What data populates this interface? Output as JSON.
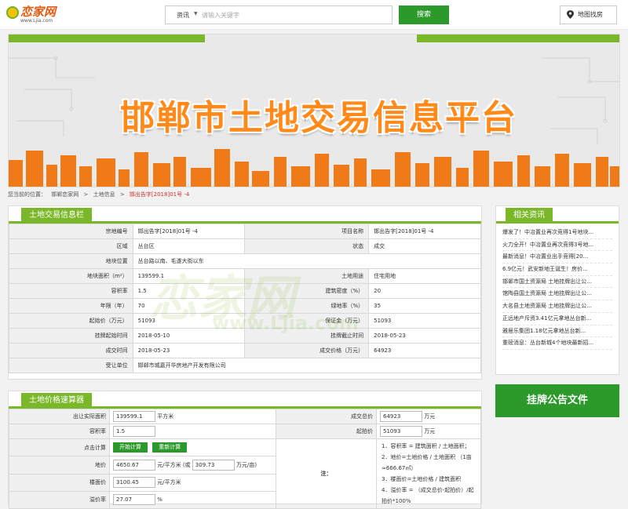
{
  "header": {
    "logo_text": "恋家网",
    "logo_sub": "www.Ljia.com",
    "search_category": "资讯",
    "search_placeholder": "请输入关键字",
    "search_button": "搜索",
    "map_button": "地图找房"
  },
  "banner": {
    "title": "邯郸市土地交易信息平台"
  },
  "breadcrumb": {
    "prefix": "您当前的位置：",
    "items": [
      "邯郸恋家网",
      ">",
      "土地信息",
      ">",
      "邯出告字[2018]01号 -4"
    ]
  },
  "land_info": {
    "title": "土地交易信息栏",
    "rows": [
      {
        "k1": "宗地编号",
        "v1": "邯出告字[2018]01号 -4",
        "k2": "项目名称",
        "v2": "邯出告字[2018]01号 -4"
      },
      {
        "k1": "区域",
        "v1": "丛台区",
        "k2": "状态",
        "v2": "成交"
      },
      {
        "k1": "地块位置",
        "v1": "丛台路以南、毛遂大街以东",
        "k2": "",
        "v2": ""
      },
      {
        "k1": "地块面积（m²）",
        "v1": "139599.1",
        "k2": "土地用途",
        "v2": "住宅用地"
      },
      {
        "k1": "容积率",
        "v1": "1.5",
        "k2": "建筑密度（%）",
        "v2": "20"
      },
      {
        "k1": "年限（年）",
        "v1": "70",
        "k2": "绿地率（%）",
        "v2": "35"
      },
      {
        "k1": "起始价（万元）",
        "v1": "51093",
        "k2": "保证金（万元）",
        "v2": "51093"
      },
      {
        "k1": "挂牌起始时间",
        "v1": "2018-05-10",
        "k2": "挂牌截止时间",
        "v2": "2018-05-23"
      },
      {
        "k1": "成交时间",
        "v1": "2018-05-23",
        "k2": "成交价格（万元）",
        "v2": "64923"
      },
      {
        "k1": "受让单位",
        "v1": "邯郸市城嘉开华房地产开发有限公司",
        "k2": "",
        "v2": ""
      }
    ]
  },
  "watermark": {
    "text": "恋家网",
    "sub": "www.Ljia.com"
  },
  "calculator": {
    "title": "土地价格速算器",
    "area_label": "出让实际面积",
    "area_value": "139599.1",
    "area_unit": "平方米",
    "deal_label": "成交总价",
    "deal_value": "64923",
    "deal_unit": "万元",
    "far_label": "容积率",
    "far_value": "1.5",
    "start_label": "起拍价",
    "start_value": "51093",
    "start_unit": "万元",
    "action_label": "点击计算",
    "calc_button": "开始计算",
    "reset_button": "重新计算",
    "land_price_label": "地价",
    "land_price_value": "4650.67",
    "land_price_unit": "元/平方米 (或",
    "land_price_mu": "309.73",
    "land_price_mu_unit": "万元/亩)",
    "floor_price_label": "楼面价",
    "floor_price_value": "3100.45",
    "floor_price_unit": "元/平方米",
    "premium_label": "溢价率",
    "premium_value": "27.07",
    "premium_unit": "%",
    "note_label": "注：",
    "notes": [
      "1．容积率 = 建筑面积 / 土地面积；",
      "2．地价=土地价格 / 土地面积 （1亩≈666.67㎡）",
      "3．楼面价=土地价格 / 建筑面积",
      "4．溢价率 = （成交总价-起拍价）/起拍价*100%"
    ]
  },
  "sidebar": {
    "title": "相关资讯",
    "items": [
      "爆发了！中冶置业再次竞得1号地块...",
      "火力全开！中冶置业再次竞得3号地...",
      "最新消息！中冶置业出手竞得[20...",
      "6.9亿元！武安新地王诞生！房价...",
      "邯郸市国土资源局 土地挂牌出让公...",
      "馆陶县国土资源局 土地挂牌出让公...",
      "大名县土地资源局 土地挂牌出让公...",
      "正远地产斥资3.41亿元拿地丛台新...",
      "雅居乐集团1.18亿元拿地丛台新...",
      "重磅消息：丛台新城4个地块最新招..."
    ],
    "notice_button": "挂牌公告文件"
  },
  "colors": {
    "brand_green": "#7ab829",
    "button_green": "#2b9a2b",
    "banner_orange": "#ff8a1a",
    "highlight_red": "#d03030"
  }
}
